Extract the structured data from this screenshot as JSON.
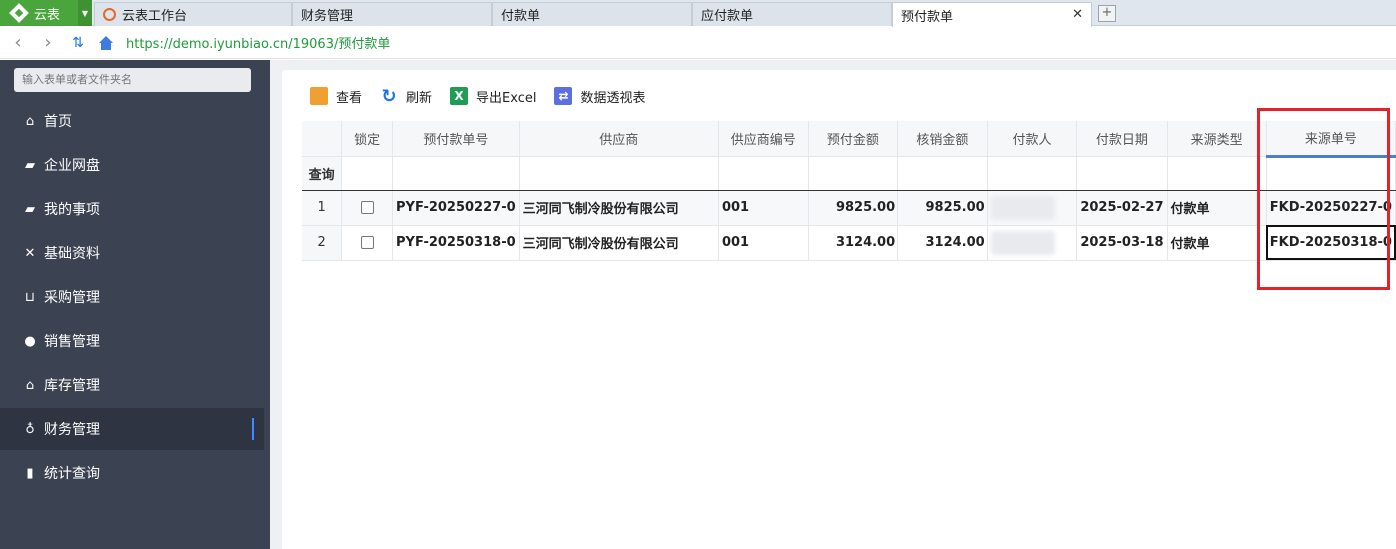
{
  "app": {
    "name": "云表"
  },
  "tabs": [
    {
      "label": "云表工作台"
    },
    {
      "label": "财务管理"
    },
    {
      "label": "付款单"
    },
    {
      "label": "应付款单"
    },
    {
      "label": "预付款单",
      "active": true
    }
  ],
  "address": {
    "url": "https://demo.iyunbiao.cn/19063/预付款单"
  },
  "sidebar": {
    "search_placeholder": "输入表单或者文件夹名",
    "items": [
      {
        "label": "首页",
        "icon": "home-icon"
      },
      {
        "label": "企业网盘",
        "icon": "folder-icon"
      },
      {
        "label": "我的事项",
        "icon": "folder-icon"
      },
      {
        "label": "基础资料",
        "icon": "tools-icon"
      },
      {
        "label": "采购管理",
        "icon": "cart-icon"
      },
      {
        "label": "销售管理",
        "icon": "user-icon"
      },
      {
        "label": "库存管理",
        "icon": "home-icon"
      },
      {
        "label": "财务管理",
        "icon": "money-bag-icon",
        "active": true
      },
      {
        "label": "统计查询",
        "icon": "bar-chart-icon"
      }
    ]
  },
  "toolbar": {
    "view": "查看",
    "refresh": "刷新",
    "export": "导出Excel",
    "pivot": "数据透视表"
  },
  "grid": {
    "columns": [
      "锁定",
      "预付款单号",
      "供应商",
      "供应商编号",
      "预付金额",
      "核销金额",
      "付款人",
      "付款日期",
      "来源类型",
      "来源单号"
    ],
    "filter_label": "查询",
    "rows": [
      {
        "index": "1",
        "order_no": "PYF-20250227-0",
        "supplier": "三河同飞制冷股份有限公司",
        "supplier_code": "001",
        "prepay_amount": "9825.00",
        "writeoff_amount": "9825.00",
        "pay_date": "2025-02-27",
        "source_type": "付款单",
        "source_no": "FKD-20250227-0",
        "overflow": "2"
      },
      {
        "index": "2",
        "order_no": "PYF-20250318-0",
        "supplier": "三河同飞制冷股份有限公司",
        "supplier_code": "001",
        "prepay_amount": "3124.00",
        "writeoff_amount": "3124.00",
        "pay_date": "2025-03-18",
        "source_type": "付款单",
        "source_no": "FKD-20250318-0",
        "overflow": "2"
      }
    ]
  },
  "colors": {
    "brand": "#4aa63c",
    "sidebar": "#3b4252",
    "highlight": "#e3232a",
    "url": "#1e9b3b"
  }
}
